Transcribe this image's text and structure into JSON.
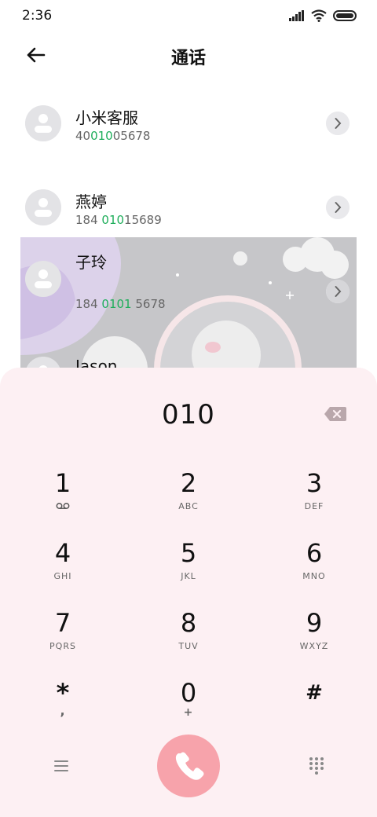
{
  "status": {
    "time": "2:36"
  },
  "header": {
    "title": "通话"
  },
  "contacts": [
    {
      "name": "小米客服",
      "num_pre": "40",
      "num_hl": "010",
      "num_post": "05678"
    },
    {
      "name": "燕婷",
      "num_pre": "184 ",
      "num_hl": "010",
      "num_post": "15689"
    },
    {
      "name": "子玲",
      "num_pre": "184 ",
      "num_hl": "0101",
      "num_post": " 5678"
    },
    {
      "name": "Jason",
      "num_pre": "",
      "num_hl": "",
      "num_post": ""
    }
  ],
  "dialer": {
    "entered": "010",
    "keys": [
      {
        "digit": "1",
        "letters": ""
      },
      {
        "digit": "2",
        "letters": "ABC"
      },
      {
        "digit": "3",
        "letters": "DEF"
      },
      {
        "digit": "4",
        "letters": "GHI"
      },
      {
        "digit": "5",
        "letters": "JKL"
      },
      {
        "digit": "6",
        "letters": "MNO"
      },
      {
        "digit": "7",
        "letters": "PQRS"
      },
      {
        "digit": "8",
        "letters": "TUV"
      },
      {
        "digit": "9",
        "letters": "WXYZ"
      },
      {
        "digit": "*",
        "letters": ","
      },
      {
        "digit": "0",
        "letters": "+"
      },
      {
        "digit": "#",
        "letters": ""
      }
    ]
  },
  "colors": {
    "accent_green": "#1fae5b",
    "call_button": "#f7a3ab",
    "dialpad_bg": "#fdf0f3"
  }
}
